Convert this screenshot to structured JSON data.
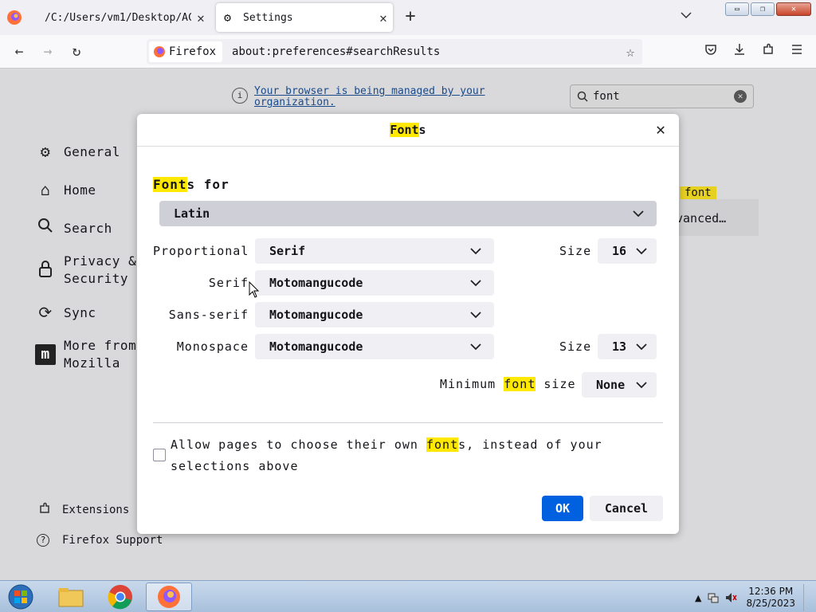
{
  "tabs": [
    {
      "title": "/C:/Users/vm1/Desktop/AC",
      "close": "✕"
    },
    {
      "title": "Settings",
      "close": "✕"
    }
  ],
  "tabbar": {
    "new_tab": "+",
    "list_tabs": "⌄"
  },
  "window_buttons": {
    "minimize": "▭",
    "restore": "❐",
    "close": "✕"
  },
  "navbar": {
    "back": "←",
    "forward": "→",
    "reload": "↻",
    "identity_label": "Firefox",
    "url": "about:preferences#searchResults",
    "bookmark": "☆"
  },
  "page": {
    "managed_notice": "Your browser is being managed by your organization.",
    "search_value": "font",
    "search_clear": "✕",
    "sidebar": [
      {
        "icon": "gear-icon",
        "glyph": "⚙",
        "label": "General"
      },
      {
        "icon": "home-icon",
        "glyph": "⌂",
        "label": "Home"
      },
      {
        "icon": "search-icon",
        "glyph": "⚲",
        "label": "Search"
      },
      {
        "icon": "lock-icon",
        "glyph": "🔒",
        "label": "Privacy & Security"
      },
      {
        "icon": "sync-icon",
        "glyph": "⟳",
        "label": "Sync"
      },
      {
        "icon": "mozilla-icon",
        "glyph": "m",
        "label": "More from Mozilla"
      }
    ],
    "footer": [
      {
        "icon": "puzzle-icon",
        "glyph": "⚙",
        "label": "Extensions"
      },
      {
        "icon": "help-icon",
        "glyph": "?",
        "label": "Firefox Support"
      }
    ],
    "bg_highlight": "font",
    "bg_advanced": "vanced…"
  },
  "dialog": {
    "title_hl": "Font",
    "title_rest": "s",
    "close": "✕",
    "fonts_for_hl": "Font",
    "fonts_for_rest": "s for",
    "language": "Latin",
    "rows": {
      "proportional": {
        "label": "Proportional",
        "value": "Serif",
        "size_label": "Size",
        "size": "16"
      },
      "serif": {
        "label": "Serif",
        "value": "Motomangucode"
      },
      "sans_serif": {
        "label": "Sans-serif",
        "value": "Motomangucode"
      },
      "monospace": {
        "label": "Monospace",
        "value": "Motomangucode",
        "size_label": "Size",
        "size": "13"
      }
    },
    "min_font": {
      "pre": "Minimum ",
      "hl": "font",
      "post": " size",
      "value": "None"
    },
    "allow": {
      "pre": "Allow pages to choose their own ",
      "hl": "font",
      "post": "s, instead of your selections above"
    },
    "ok": "OK",
    "cancel": "Cancel"
  },
  "taskbar": {
    "time": "12:36 PM",
    "date": "8/25/2023",
    "tray_arrow": "▲"
  },
  "colors": {
    "accent": "#0061e0",
    "highlight": "#ffe900"
  }
}
